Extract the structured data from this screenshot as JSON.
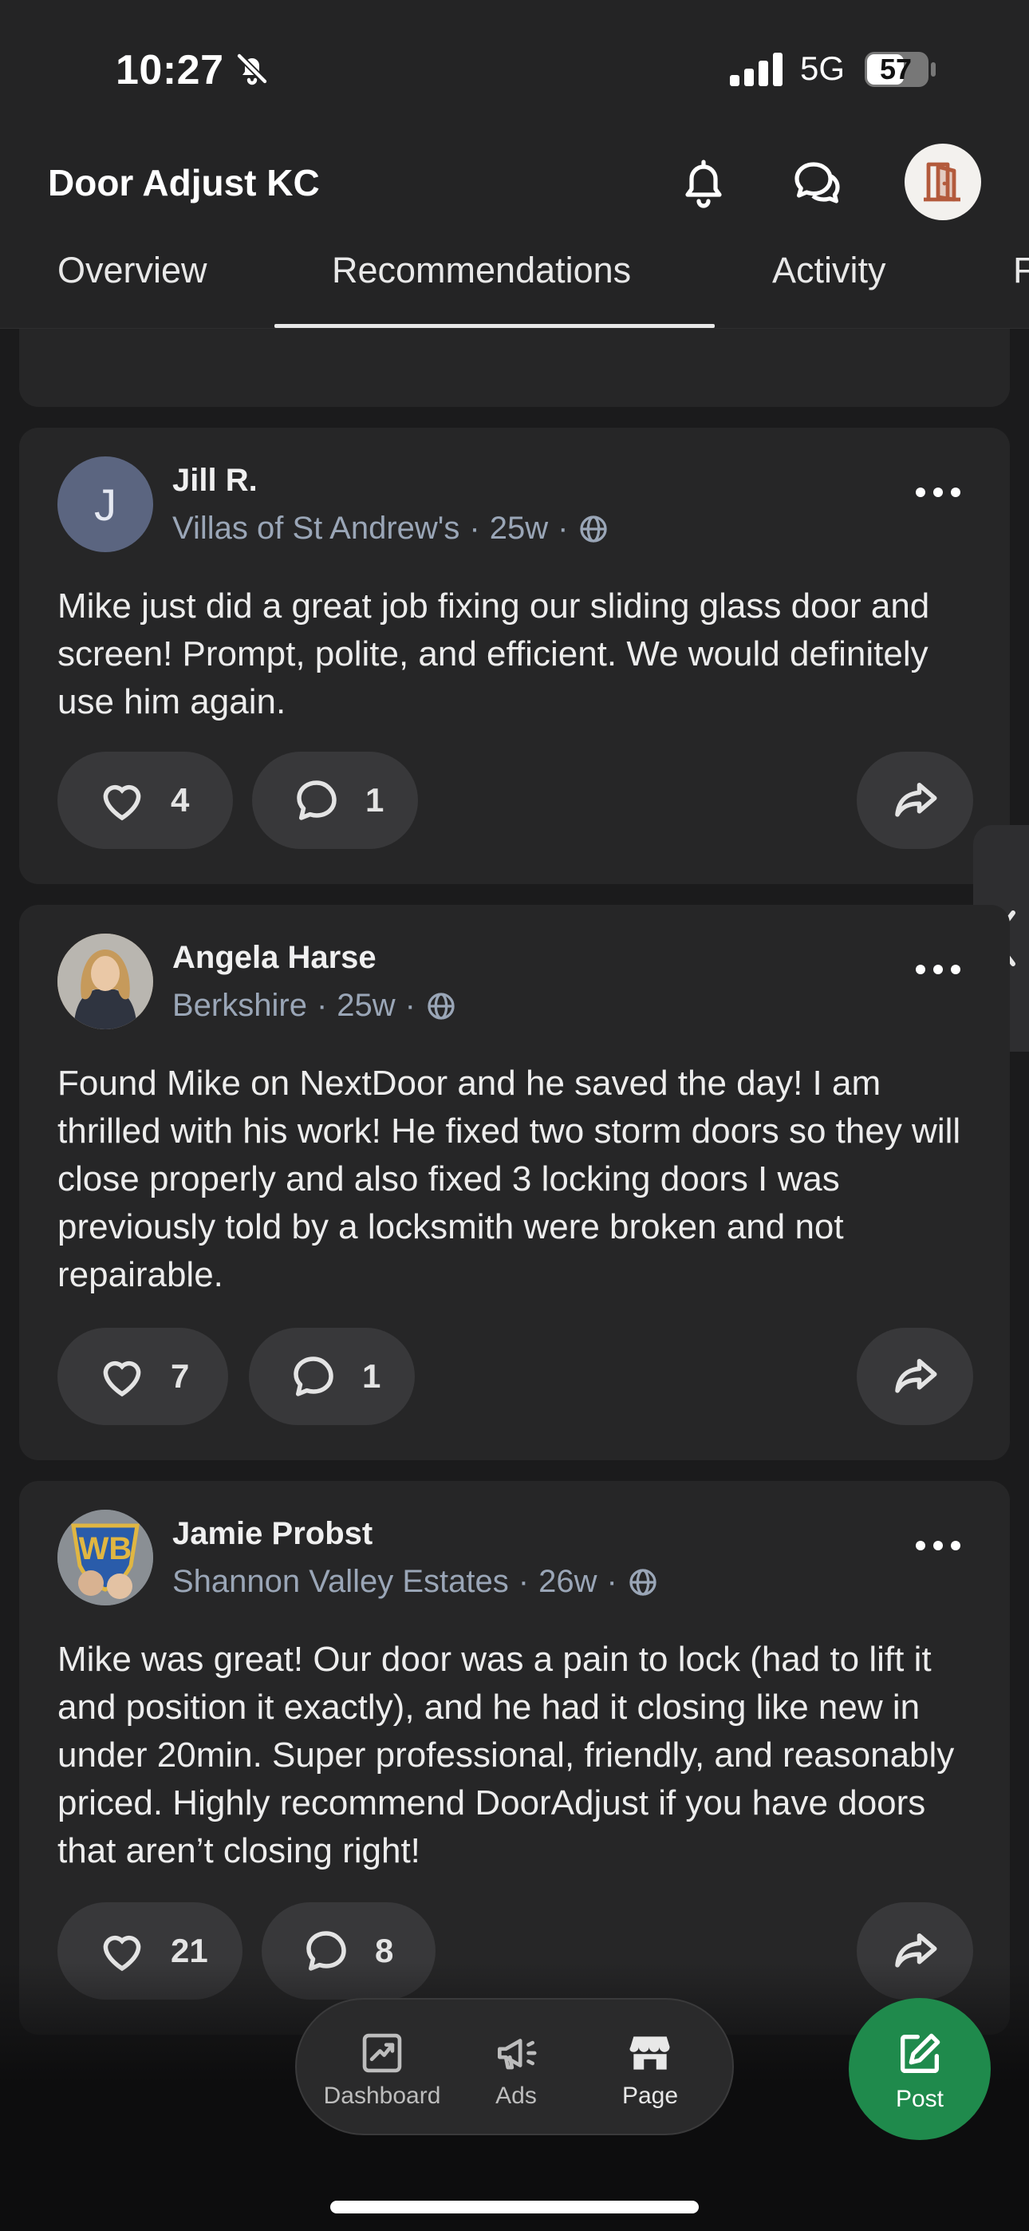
{
  "status_bar": {
    "time": "10:27",
    "network": "5G",
    "battery": "57"
  },
  "header": {
    "title": "Door Adjust KC"
  },
  "tabs": [
    {
      "label": "Overview"
    },
    {
      "label": "Recommendations",
      "active": true
    },
    {
      "label": "Activity"
    },
    {
      "label": "F"
    }
  ],
  "posts": [
    {
      "author": "Jill R.",
      "avatar_initial": "J",
      "neighborhood": "Villas of St Andrew's",
      "age": "25w",
      "text": "Mike just did a great job fixing our sliding glass door and screen! Prompt, polite, and efficient. We would definitely use him again.",
      "likes": "4",
      "comments": "1"
    },
    {
      "author": "Angela Harse",
      "neighborhood": "Berkshire",
      "age": "25w",
      "text": "Found Mike on NextDoor and he saved the day! I am thrilled with his work! He fixed two storm doors so they will close properly and also fixed 3 locking doors I was previously told by a locksmith were broken and not repairable.",
      "likes": "7",
      "comments": "1"
    },
    {
      "author": "Jamie Probst",
      "neighborhood": "Shannon Valley Estates",
      "age": "26w",
      "text": "Mike was great! Our door was a pain to lock (had to lift it and position it exactly), and he had it closing like new in under 20min. Super professional, friendly, and reasonably priced. Highly recommend DoorAdjust if you have doors that aren’t closing right!",
      "likes": "21",
      "comments": "8"
    }
  ],
  "separator": "·",
  "bottom_nav": [
    {
      "label": "Dashboard",
      "icon": "chart-trend-icon"
    },
    {
      "label": "Ads",
      "icon": "megaphone-icon"
    },
    {
      "label": "Page",
      "icon": "storefront-icon"
    }
  ],
  "post_button": {
    "label": "Post",
    "icon": "edit-icon"
  },
  "colors": {
    "background": "#1b1b1c",
    "card": "#262627",
    "pill": "#38383a",
    "meta": "#9aa6b7",
    "post_green": "#1f8a4c"
  }
}
